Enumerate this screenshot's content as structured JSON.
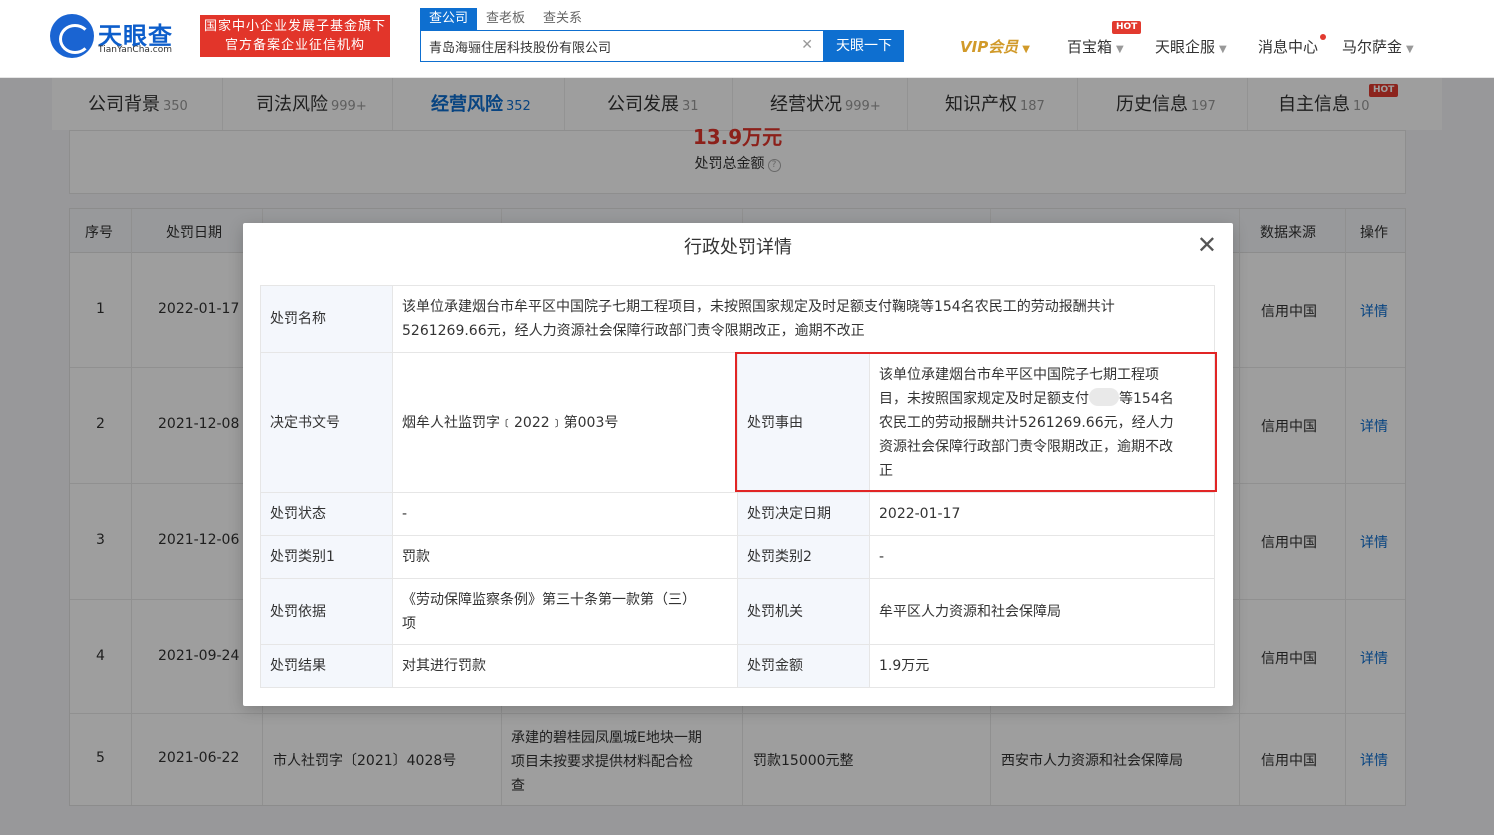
{
  "header": {
    "logo_cn": "天眼查",
    "logo_en": "TianYanCha.com",
    "slogan_line1": "国家中小企业发展子基金旗下",
    "slogan_line2": "官方备案企业征信机构",
    "search_tabs": [
      "查公司",
      "查老板",
      "查关系"
    ],
    "search_value": "青岛海骊住居科技股份有限公司",
    "search_button": "天眼一下",
    "nav": {
      "vip": "VIP会员",
      "baibaoxiang": "百宝箱",
      "hot": "HOT",
      "qifu": "天眼企服",
      "messages": "消息中心",
      "user": "马尔萨金"
    }
  },
  "tabs": [
    {
      "label": "公司背景",
      "count": "350"
    },
    {
      "label": "司法风险",
      "count": "999+"
    },
    {
      "label": "经营风险",
      "count": "352"
    },
    {
      "label": "公司发展",
      "count": "31"
    },
    {
      "label": "经营状况",
      "count": "999+"
    },
    {
      "label": "知识产权",
      "count": "187"
    },
    {
      "label": "历史信息",
      "count": "197"
    },
    {
      "label": "自主信息",
      "count": "10"
    }
  ],
  "tab_hot": "HOT",
  "summary": {
    "amount": "13.9万元",
    "label": "处罚总金额"
  },
  "table": {
    "headers": {
      "index": "序号",
      "date": "处罚日期",
      "source": "数据来源",
      "action": "操作"
    },
    "rows": [
      {
        "index": "1",
        "date": "2022-01-17",
        "source": "信用中国",
        "action": "详情"
      },
      {
        "index": "2",
        "date": "2021-12-08",
        "source": "信用中国",
        "action": "详情"
      },
      {
        "index": "3",
        "date": "2021-12-06",
        "source": "信用中国",
        "action": "详情"
      },
      {
        "index": "4",
        "date": "2021-09-24",
        "source": "信用中国",
        "action": "详情"
      },
      {
        "index": "5",
        "date": "2021-06-22",
        "doc": "市人社罚字〔2021〕4028号",
        "content_line1": "承建的碧桂园凤凰城E地块一期",
        "content_line2": "项目未按要求提供材料配合检",
        "content_line3": "查",
        "result": "罚款15000元整",
        "authority": "西安市人力资源和社会保障局",
        "source": "信用中国",
        "action": "详情"
      }
    ]
  },
  "modal": {
    "title": "行政处罚详情",
    "name_label": "处罚名称",
    "name_line1": "该单位承建烟台市牟平区中国院子七期工程项目，未按照国家规定及时足额支付鞠晓等154名农民工的劳动报酬共计",
    "name_line2": "5261269.66元，经人力资源社会保障行政部门责令限期改正，逾期不改正",
    "doc_label": "决定书文号",
    "doc_value": "烟牟人社监罚字﹝2022﹞第003号",
    "reason_label": "处罚事由",
    "reason_line1": "该单位承建烟台市牟平区中国院子七期工程项",
    "reason_line2a": "目，未按照国家规定及时足额支付",
    "reason_line2b": "等154名",
    "reason_line3": "农民工的劳动报酬共计5261269.66元，经人力",
    "reason_line4": "资源社会保障行政部门责令限期改正，逾期不改",
    "reason_line5": "正",
    "status_label": "处罚状态",
    "status_value": "-",
    "decision_date_label": "处罚决定日期",
    "decision_date_value": "2022-01-17",
    "cat1_label": "处罚类别1",
    "cat1_value": "罚款",
    "cat2_label": "处罚类别2",
    "cat2_value": "-",
    "basis_label": "处罚依据",
    "basis_line1": "《劳动保障监察条例》第三十条第一款第（三）",
    "basis_line2": "项",
    "authority_label": "处罚机关",
    "authority_value": "牟平区人力资源和社会保障局",
    "result_label": "处罚结果",
    "result_value": "对其进行罚款",
    "amount_label": "处罚金额",
    "amount_value": "1.9万元"
  },
  "colors": {
    "brand": "#0e6fd0",
    "alert": "#e2352a",
    "highlight_box": "#e12525"
  }
}
